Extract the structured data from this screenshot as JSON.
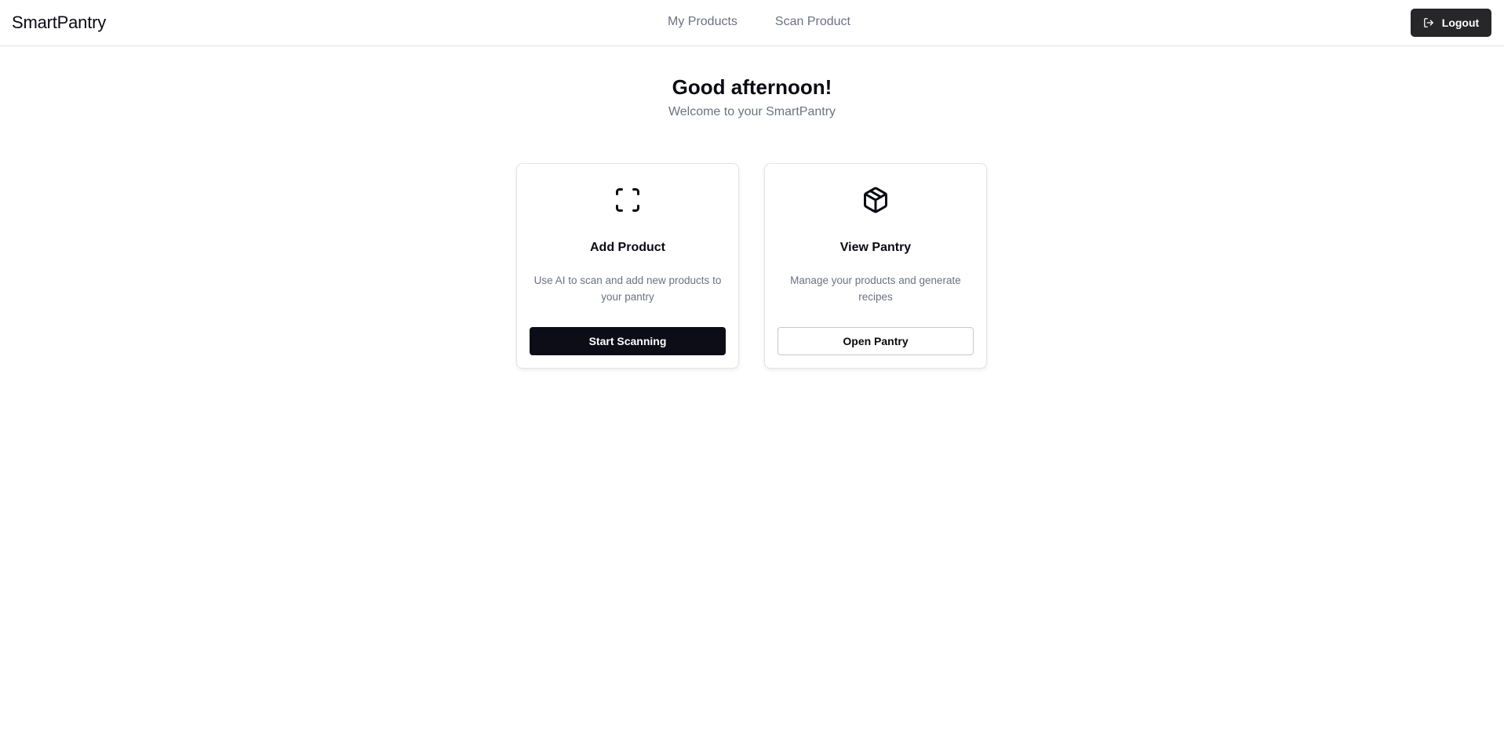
{
  "app": {
    "brand": "SmartPantry"
  },
  "nav": {
    "links": [
      {
        "label": "My Products"
      },
      {
        "label": "Scan Product"
      }
    ],
    "logout_label": "Logout"
  },
  "hero": {
    "title": "Good afternoon!",
    "subtitle": "Welcome to your SmartPantry"
  },
  "cards": [
    {
      "icon": "scan-icon",
      "title": "Add Product",
      "description": "Use AI to scan and add new products to your pantry",
      "button_label": "Start Scanning"
    },
    {
      "icon": "package-icon",
      "title": "View Pantry",
      "description": "Manage your products and generate recipes",
      "button_label": "Open Pantry"
    }
  ],
  "colors": {
    "primary": "#0d0d18",
    "logout_bg": "#27272a",
    "muted_text": "#6b7280",
    "border": "#e4e4e7"
  }
}
